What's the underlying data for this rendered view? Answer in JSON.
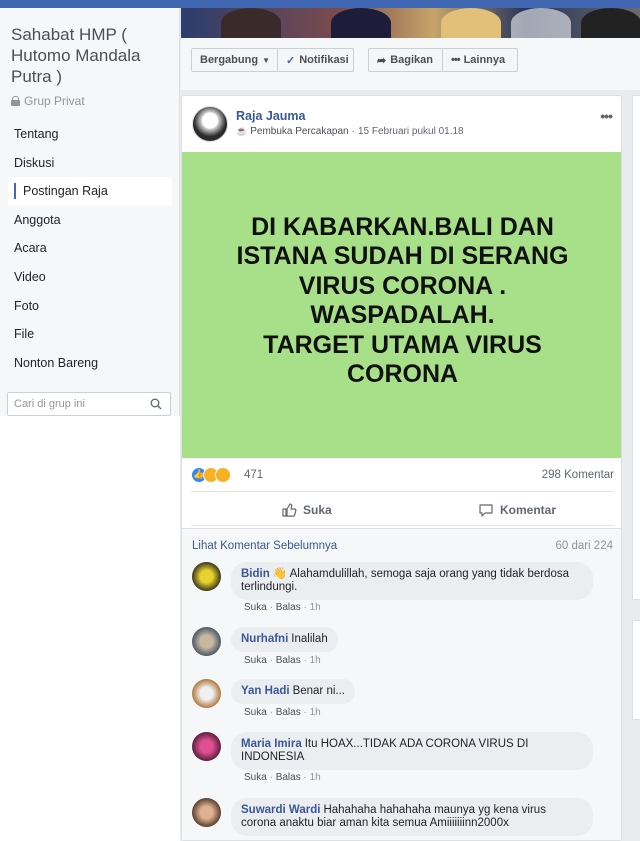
{
  "group": {
    "title": "Sahabat HMP ( Hutomo Mandala Putra )",
    "privacy": "Grup Privat",
    "nav": [
      "Tentang",
      "Diskusi",
      "Postingan Raja",
      "Anggota",
      "Acara",
      "Video",
      "Foto",
      "File",
      "Nonton Bareng"
    ],
    "search_placeholder": "Cari di grup ini"
  },
  "actions": {
    "join": "Bergabung",
    "notify": "Notifikasi",
    "share": "Bagikan",
    "more": "Lainnya"
  },
  "post": {
    "author": "Raja Jauma",
    "role": "Pembuka Percakapan",
    "time": "15 Februari pukul 01.18",
    "image_text": "DI KABARKAN.BALI DAN\nISTANA SUDAH DI SERANG\nVIRUS CORONA .\nWASPADALAH.\nTARGET UTAMA VIRUS\nCORONA",
    "image_color": "#a8e08a",
    "reaction_count": "471",
    "comment_count": "298 Komentar",
    "like_label": "Suka",
    "comment_label": "Komentar"
  },
  "comments_section": {
    "prev_link": "Lihat Komentar Sebelumnya",
    "page_count": "60 dari 224",
    "like_action": "Suka",
    "reply_action": "Balas",
    "items": [
      {
        "name": "Bidin",
        "text": "👋 Alahamdulillah, semoga saja orang yang tidak berdosa terlindungi.",
        "time": "1h"
      },
      {
        "name": "Nurhafni",
        "text": "Inalilah",
        "time": "1h"
      },
      {
        "name": "Yan Hadi",
        "text": "Benar ni...",
        "time": "1h"
      },
      {
        "name": "Maria Imira",
        "text": "Itu HOAX...TIDAK ADA CORONA VIRUS DI INDONESIA",
        "time": "1h"
      },
      {
        "name": "Suwardi Wardi",
        "text": "Hahahaha hahahaha maunya yg kena virus corona anaktu biar aman kita semua Amiiiiiiinn2000x",
        "time": ""
      }
    ]
  }
}
